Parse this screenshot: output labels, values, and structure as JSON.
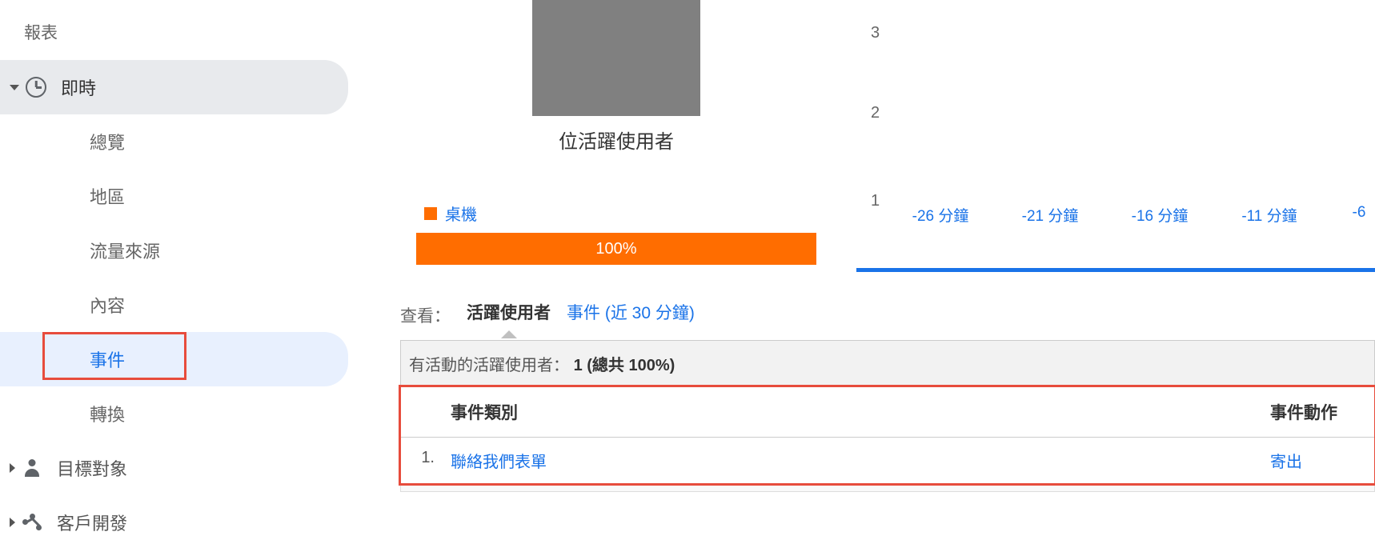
{
  "sidebar": {
    "header": "報表",
    "realtime": {
      "label": "即時",
      "items": [
        {
          "label": "總覽"
        },
        {
          "label": "地區"
        },
        {
          "label": "流量來源"
        },
        {
          "label": "內容"
        },
        {
          "label": "事件"
        },
        {
          "label": "轉換"
        }
      ]
    },
    "audience": "目標對象",
    "acquisition": "客戶開發"
  },
  "main": {
    "active_users_label": "位活躍使用者",
    "device_legend": "桌機",
    "progress_value": "100%",
    "tabs": {
      "label": "查看：",
      "active": "活躍使用者",
      "events_link": "事件 (近 30 分鐘)"
    },
    "summary": {
      "prefix": "有活動的活躍使用者：",
      "value": "1 (總共 100%)"
    },
    "table": {
      "headers": {
        "category": "事件類別",
        "action": "事件動作"
      },
      "rows": [
        {
          "idx": "1.",
          "category": "聯絡我們表單",
          "action": "寄出"
        }
      ]
    }
  },
  "chart_data": {
    "type": "bar",
    "y_ticks": [
      "3",
      "2",
      "1"
    ],
    "x_labels": [
      "-26 分鐘",
      "-21 分鐘",
      "-16 分鐘",
      "-11 分鐘",
      "-6"
    ],
    "ylim": [
      0,
      3
    ]
  }
}
